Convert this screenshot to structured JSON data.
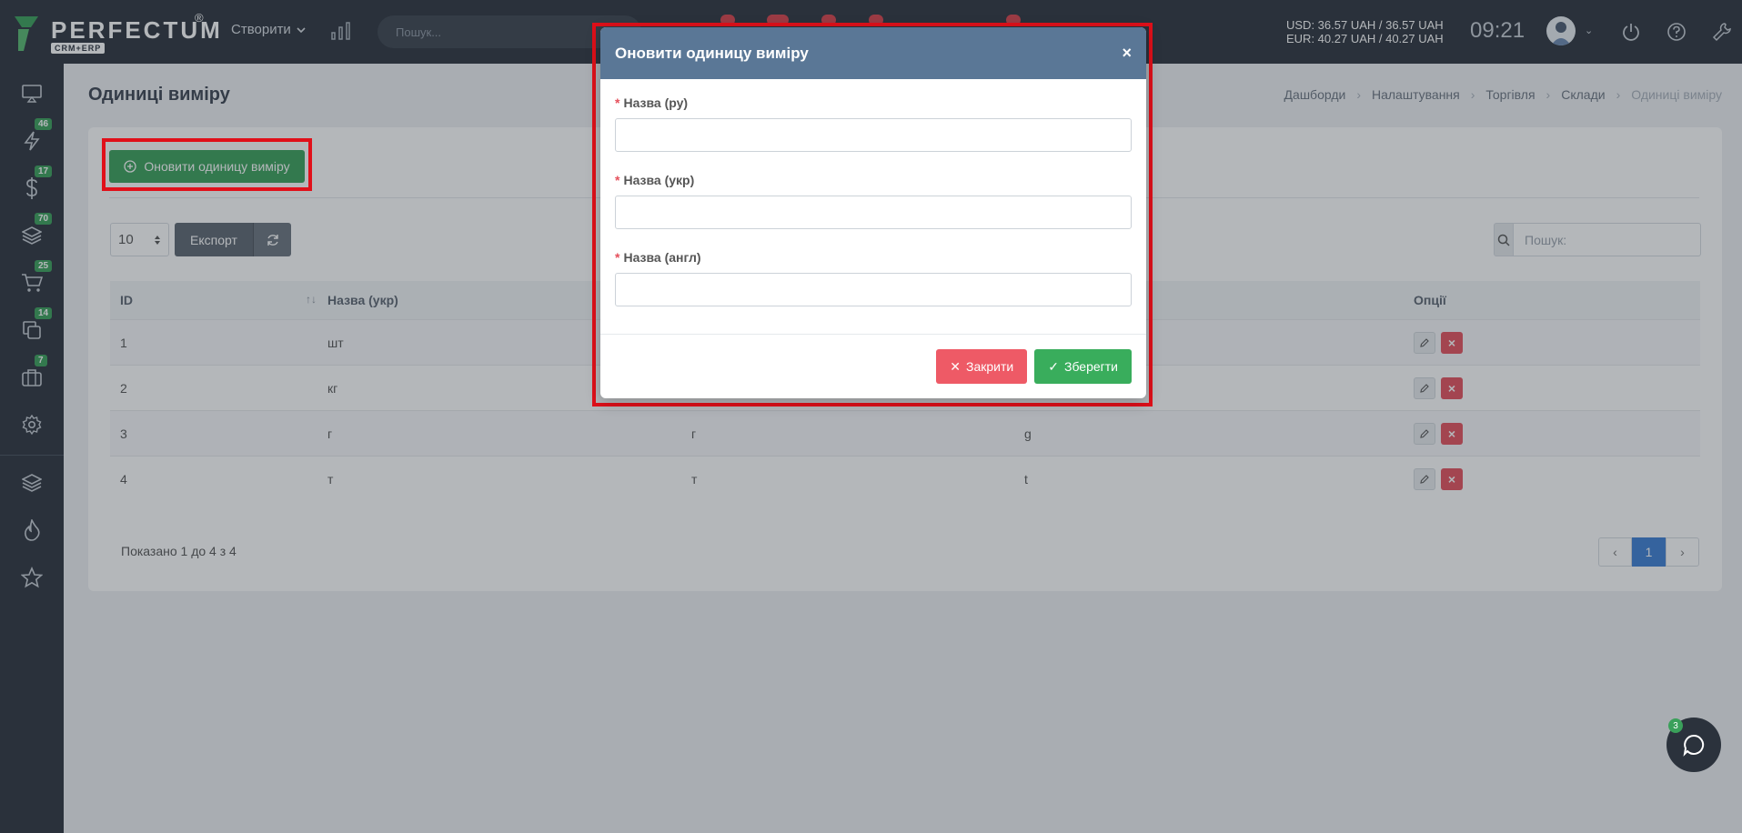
{
  "header": {
    "logo_text": "PERFECTUM",
    "logo_reg": "®",
    "logo_sub": "CRM+ERP",
    "create_label": "Створити",
    "search_placeholder": "Пошук...",
    "currency_usd": "USD: 36.57 UAH / 36.57 UAH",
    "currency_eur": "EUR: 40.27 UAH / 40.27 UAH",
    "time": "09:21"
  },
  "sidebar": {
    "items": [
      {
        "icon": "monitor-icon",
        "badge": ""
      },
      {
        "icon": "lightning-icon",
        "badge": "46"
      },
      {
        "icon": "dollar-icon",
        "badge": "17"
      },
      {
        "icon": "layers-icon",
        "badge": "70"
      },
      {
        "icon": "cart-icon",
        "badge": "25"
      },
      {
        "icon": "copy-icon",
        "badge": "14"
      },
      {
        "icon": "briefcase-icon",
        "badge": "7"
      },
      {
        "icon": "gear-icon",
        "badge": ""
      },
      {
        "icon": "layers-icon",
        "badge": ""
      },
      {
        "icon": "fire-icon",
        "badge": ""
      },
      {
        "icon": "star-icon",
        "badge": ""
      }
    ]
  },
  "page": {
    "title": "Одиниці виміру",
    "breadcrumb": [
      "Дашборди",
      "Налаштування",
      "Торгівля",
      "Склади",
      "Одиниці виміру"
    ],
    "add_button": "Оновити одиницу виміру",
    "per_page": "10",
    "export_label": "Експорт",
    "search_placeholder": "Пошук:",
    "columns": {
      "id": "ID",
      "uk": "Назва (укр)",
      "options": "Опції"
    },
    "rows": [
      {
        "id": "1",
        "uk": "шт",
        "ru": "",
        "en": ""
      },
      {
        "id": "2",
        "uk": "кг",
        "ru": "",
        "en": ""
      },
      {
        "id": "3",
        "uk": "г",
        "ru": "г",
        "en": "g"
      },
      {
        "id": "4",
        "uk": "т",
        "ru": "т",
        "en": "t"
      }
    ],
    "showing": "Показано 1 до 4 з 4",
    "pager": {
      "prev": "‹",
      "current": "1",
      "next": "›"
    }
  },
  "chat": {
    "badge": "3"
  },
  "modal": {
    "title": "Оновити одиницу виміру",
    "close_x": "×",
    "fields": [
      {
        "label": "Назва (ру)",
        "value": ""
      },
      {
        "label": "Назва (укр)",
        "value": ""
      },
      {
        "label": "Назва (англ)",
        "value": ""
      }
    ],
    "required_mark": "*",
    "close_button": "Закрити",
    "save_button": "Зберегти"
  },
  "colors": {
    "accent_green": "#3aa05a",
    "danger": "#e5505c",
    "modal_header": "#5a7796",
    "topbar": "#2b323c",
    "highlight": "#e0101a"
  }
}
